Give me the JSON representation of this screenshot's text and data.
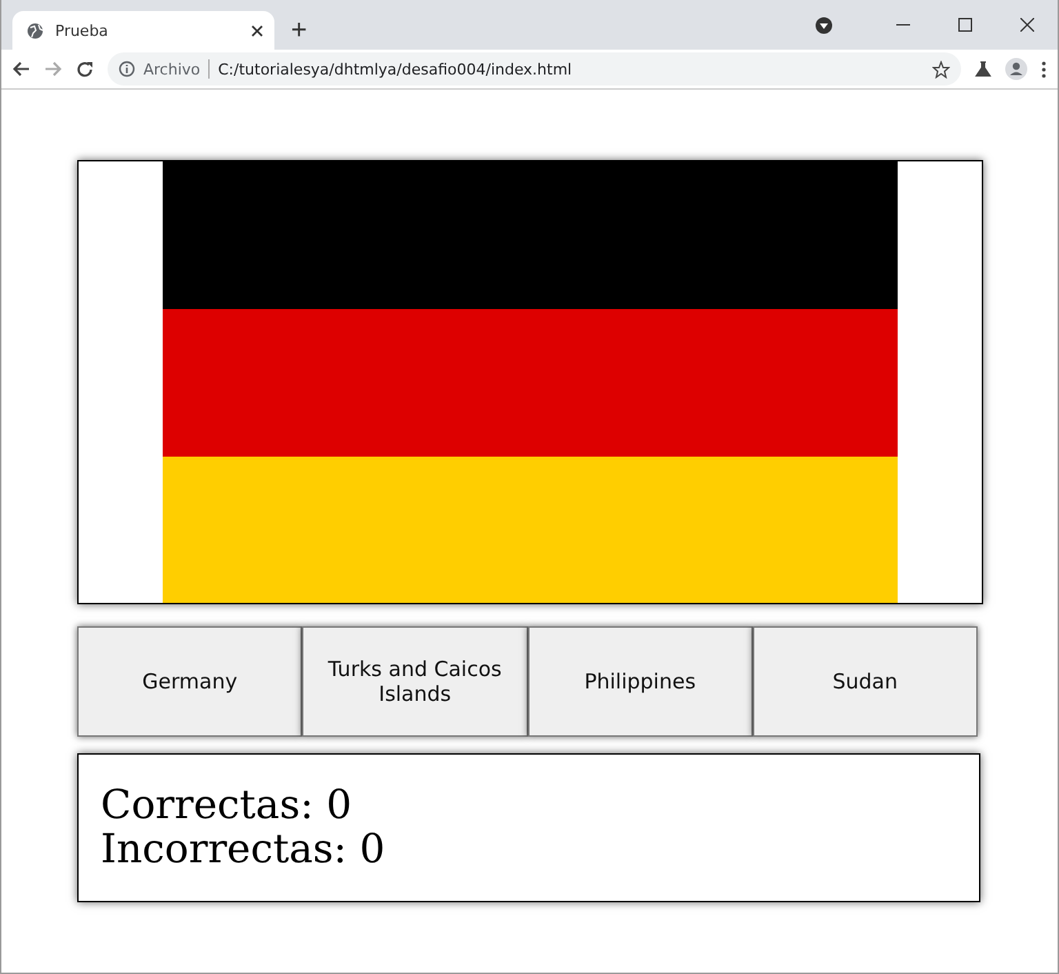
{
  "browser": {
    "tab_title": "Prueba",
    "new_tab": "+",
    "security_label": "Archivo",
    "url": "C:/tutorialesya/dhtmlya/desafio004/index.html"
  },
  "options": [
    "Germany",
    "Turks and Caicos Islands",
    "Philippines",
    "Sudan"
  ],
  "score": {
    "correct": "Correctas: 0",
    "incorrect": "Incorrectas: 0"
  }
}
